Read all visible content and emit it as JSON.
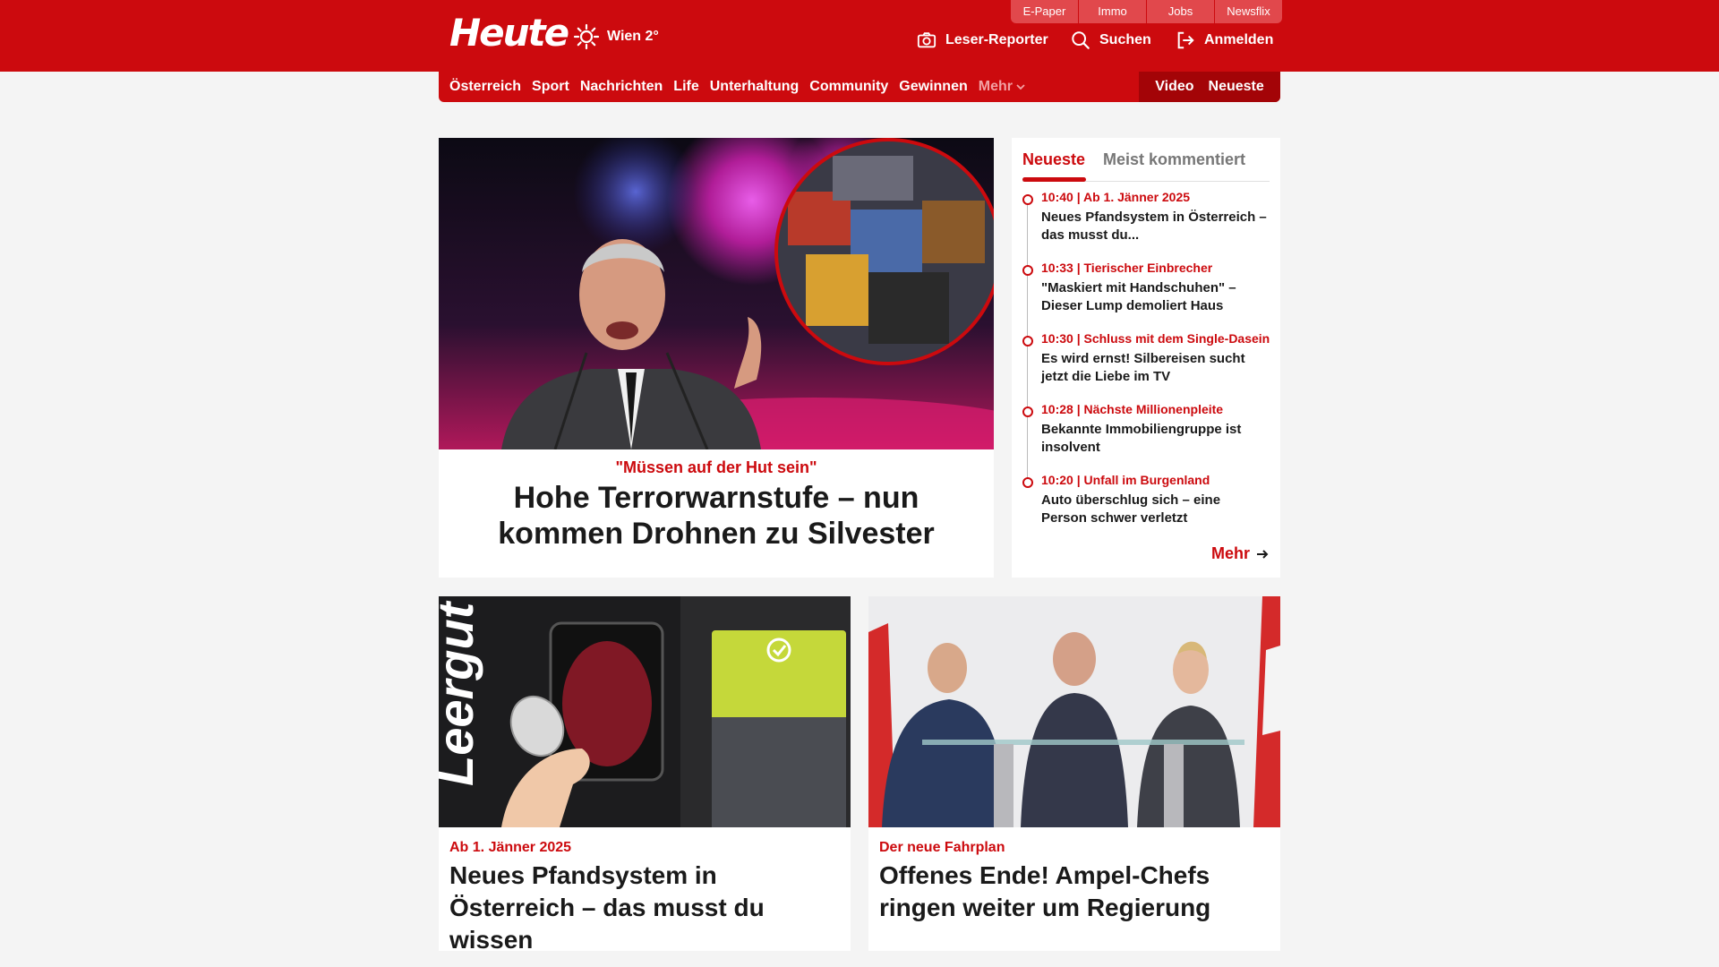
{
  "brand": {
    "logo": "Heute",
    "weather": "Wien 2°"
  },
  "top_tabs": [
    "E-Paper",
    "Immo",
    "Jobs",
    "Newsflix"
  ],
  "header_actions": {
    "reporter": "Leser-Reporter",
    "search": "Suchen",
    "login": "Anmelden"
  },
  "nav": {
    "items": [
      "Österreich",
      "Sport",
      "Nachrichten",
      "Life",
      "Unterhaltung",
      "Community",
      "Gewinnen"
    ],
    "more": "Mehr",
    "right": [
      "Video",
      "Neueste"
    ]
  },
  "hero": {
    "kicker": "\"Müssen auf der Hut sein\"",
    "title": "Hohe Terrorwarnstufe – nun kommen Drohnen zu Silvester"
  },
  "sidebar": {
    "tabs": [
      "Neueste",
      "Meist kommentiert"
    ],
    "items": [
      {
        "time": "10:40 | Ab 1. Jänner 2025",
        "text": "Neues Pfandsystem in Österreich – das musst du..."
      },
      {
        "time": "10:33 | Tierischer Einbrecher",
        "text": "\"Maskiert mit Handschuhen\" – Dieser Lump demoliert Haus"
      },
      {
        "time": "10:30 | Schluss mit dem Single-Dasein",
        "text": "Es wird ernst! Silbereisen sucht jetzt die Liebe im TV"
      },
      {
        "time": "10:28 | Nächste Millionenpleite",
        "text": "Bekannte Immobiliengruppe ist insolvent"
      },
      {
        "time": "10:20 | Unfall im Burgenland",
        "text": "Auto überschlug sich – eine Person schwer verletzt"
      }
    ],
    "more": "Mehr"
  },
  "cards": [
    {
      "kicker": "Ab 1. Jänner 2025",
      "title": "Neues Pfandsystem in Österreich – das musst du wissen",
      "img_text": "Leergut"
    },
    {
      "kicker": "Der neue Fahrplan",
      "title": "Offenes Ende! Ampel-Chefs ringen weiter um Regierung"
    }
  ],
  "colors": {
    "brand_red": "#cc0a0e",
    "nav_dark": "#a30407",
    "background": "#f4f4f4"
  }
}
